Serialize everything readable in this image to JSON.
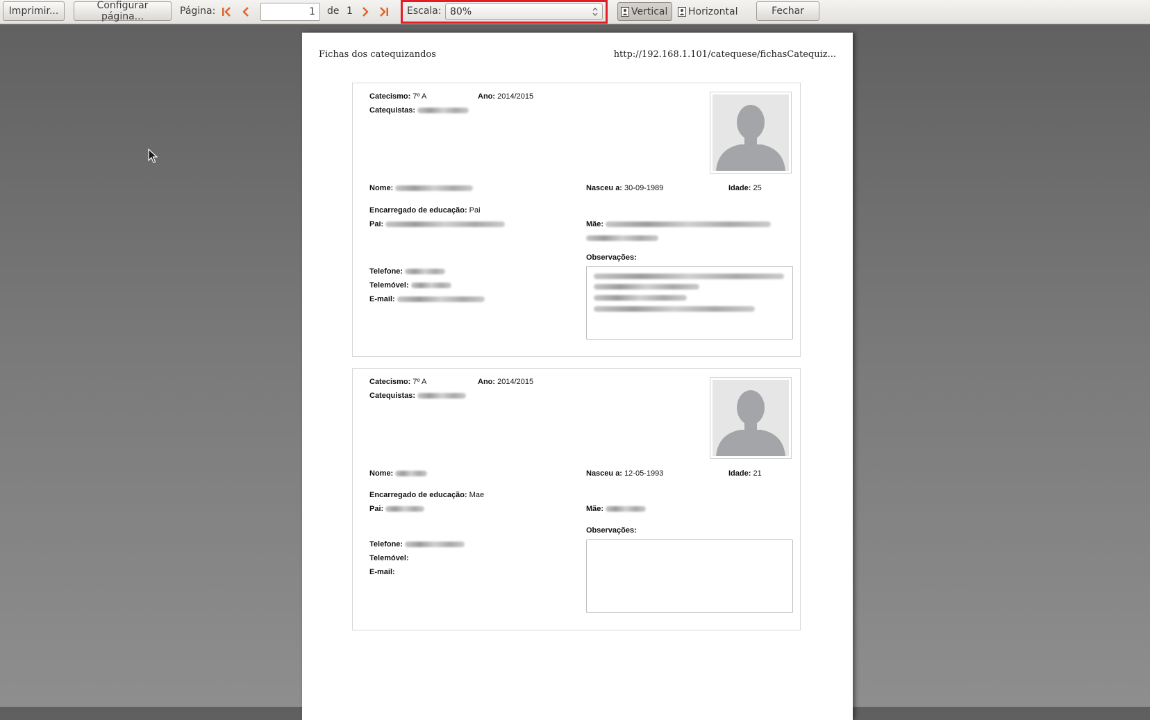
{
  "toolbar": {
    "print_label": "Imprimir...",
    "page_setup_label": "Configurar página...",
    "page_label": "Página:",
    "page_value": "1",
    "of_label": "de",
    "total_pages": "1",
    "scale_label": "Escala:",
    "scale_value": "80%",
    "portrait_label": "Vertical",
    "landscape_label": "Horizontal",
    "close_label": "Fechar"
  },
  "document": {
    "header_title": "Fichas dos catequizandos",
    "header_url": "http://192.168.1.101/catequese/fichasCatequiz..."
  },
  "labels": {
    "catecismo": "Catecismo:",
    "ano": "Ano:",
    "catequistas": "Catequistas:",
    "nome": "Nome:",
    "nasceu": "Nasceu a:",
    "idade": "Idade:",
    "encarregado": "Encarregado de educação:",
    "pai": "Pai:",
    "mae": "Mãe:",
    "observacoes": "Observações:",
    "telefone": "Telefone:",
    "telemovel": "Telemóvel:",
    "email": "E-mail:"
  },
  "cards": [
    {
      "catecismo": "7º A",
      "ano": "2014/2015",
      "nasceu": "30-09-1989",
      "idade": "25",
      "encarregado": "Pai"
    },
    {
      "catecismo": "7º A",
      "ano": "2014/2015",
      "nasceu": "12-05-1993",
      "idade": "21",
      "encarregado": "Mae"
    }
  ],
  "colors": {
    "highlight": "#e41c25",
    "nav_arrow": "#e0642a"
  }
}
